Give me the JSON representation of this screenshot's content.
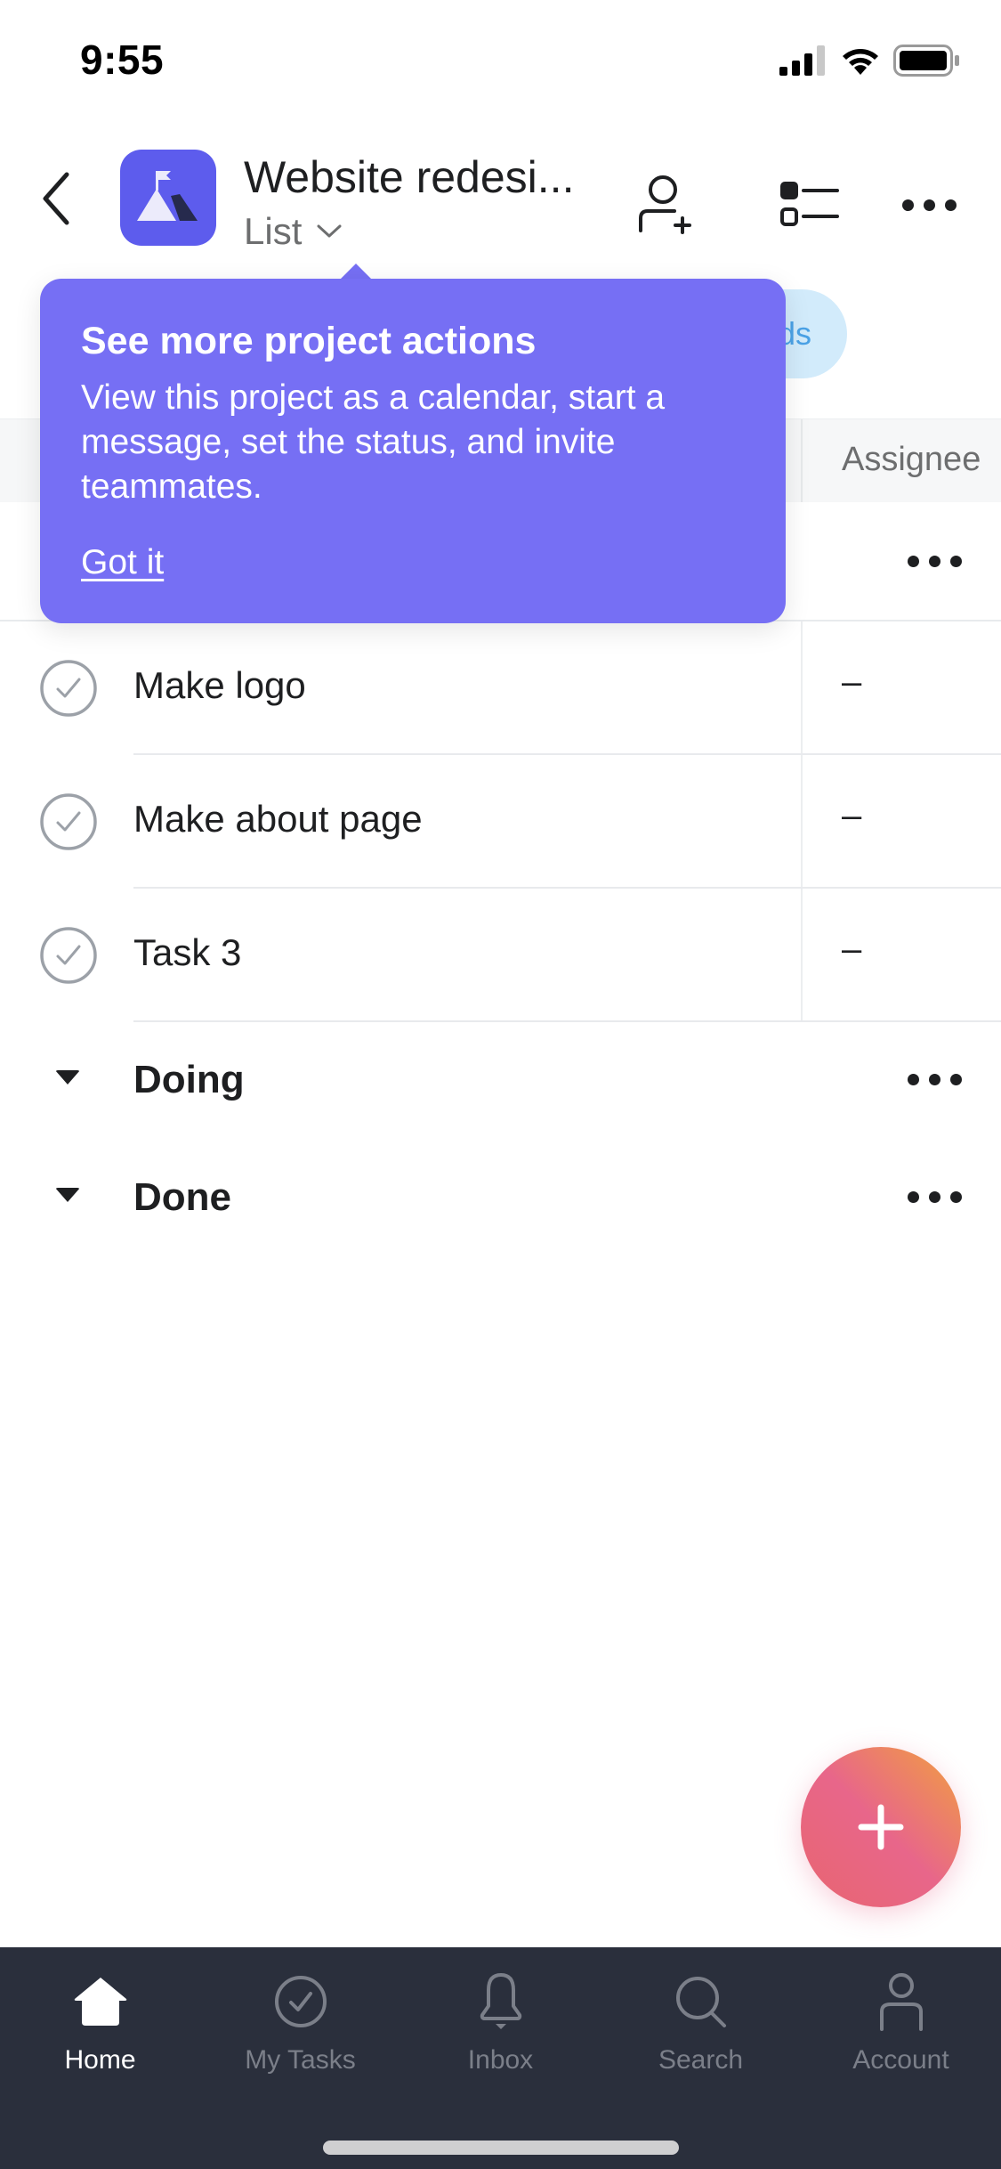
{
  "status_bar": {
    "time": "9:55",
    "icons": [
      "signal-icon",
      "wifi-icon",
      "battery-icon"
    ]
  },
  "header": {
    "back_icon": "chevron-left-icon",
    "project_icon": "mountain-flag-icon",
    "project_title": "Website redesi...",
    "view_label": "List",
    "view_chevron": "chevron-down-icon",
    "actions": [
      "add-member-icon",
      "list-options-icon",
      "more-icon"
    ]
  },
  "filter_chip": {
    "label": "ds"
  },
  "table": {
    "columns": [
      "Assignee"
    ],
    "tasks": [
      {
        "name": "Make logo",
        "assignee": "–"
      },
      {
        "name": "Make about page",
        "assignee": "–"
      },
      {
        "name": "Task 3",
        "assignee": "–"
      }
    ],
    "sections": [
      {
        "title": "Doing"
      },
      {
        "title": "Done"
      }
    ]
  },
  "tooltip": {
    "title": "See more project actions",
    "body": "View this project as a calendar, start a message, set the status, and invite teammates.",
    "action_label": "Got it"
  },
  "fab": {
    "icon": "plus-icon"
  },
  "tabbar": {
    "active": "Home",
    "tabs": [
      {
        "label": "Home",
        "icon": "home-icon"
      },
      {
        "label": "My Tasks",
        "icon": "check-circle-icon"
      },
      {
        "label": "Inbox",
        "icon": "bell-icon"
      },
      {
        "label": "Search",
        "icon": "search-icon"
      },
      {
        "label": "Account",
        "icon": "person-icon"
      }
    ]
  },
  "colors": {
    "accent": "#5d5ced",
    "tooltip_bg": "#766ff4",
    "tabbar_bg": "#2a2f3c",
    "chip_bg": "#d2ebfb",
    "chip_text": "#4ba2e6",
    "fab_gradient": [
      "#f1a03f",
      "#e8668a",
      "#e86570"
    ]
  }
}
